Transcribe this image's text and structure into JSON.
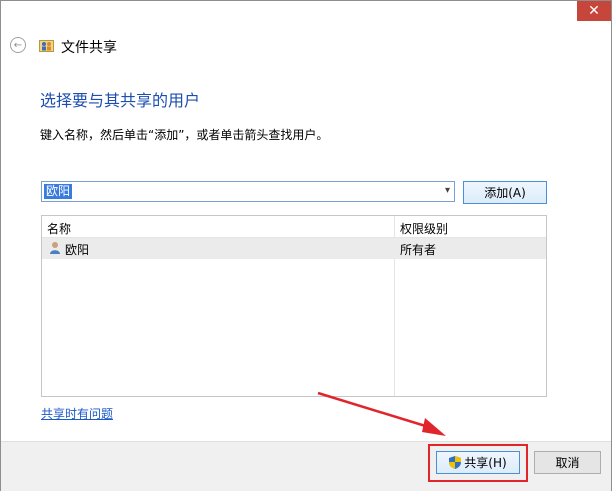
{
  "window": {
    "close_glyph": "✕"
  },
  "header": {
    "back_glyph": "←",
    "title": "文件共享",
    "app_icon": "share-users-icon"
  },
  "main": {
    "heading": "选择要与其共享的用户",
    "instruction": "键入名称，然后单击“添加”，或者单击箭头查找用户。",
    "name_input": {
      "value": "欧阳"
    },
    "add_button": "添加(A)",
    "table": {
      "columns": [
        "名称",
        "权限级别"
      ],
      "rows": [
        {
          "name": "欧阳",
          "permission": "所有者"
        }
      ]
    },
    "help_link": "共享时有问题"
  },
  "footer": {
    "share_button": "共享(H)",
    "cancel_button": "取消"
  },
  "colors": {
    "annotation": "#e0262b",
    "heading": "#1d4eb0",
    "link": "#1b58c9"
  }
}
